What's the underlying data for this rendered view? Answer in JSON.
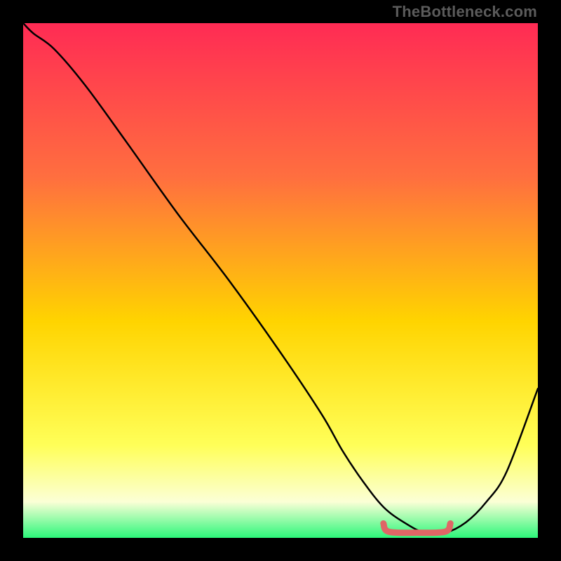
{
  "watermark": "TheBottleneck.com",
  "colors": {
    "gradient_top": "#ff2b54",
    "gradient_mid_upper": "#ff6f3f",
    "gradient_mid": "#ffd400",
    "gradient_lower": "#ffff58",
    "gradient_pale": "#fbffd6",
    "gradient_bottom": "#2cf77a",
    "curve": "#000000",
    "accent": "#e06666"
  },
  "chart_data": {
    "type": "line",
    "title": "",
    "xlabel": "",
    "ylabel": "",
    "xlim": [
      0,
      100
    ],
    "ylim": [
      0,
      100
    ],
    "grid": false,
    "legend": false,
    "series": [
      {
        "name": "bottleneck-curve",
        "x": [
          0,
          2,
          6,
          12,
          20,
          30,
          40,
          50,
          58,
          62,
          66,
          70,
          74,
          78,
          82,
          86,
          90,
          94,
          100
        ],
        "y": [
          100,
          98,
          95,
          88,
          77,
          63,
          50,
          36,
          24,
          17,
          11,
          6,
          3,
          1,
          1,
          3,
          7,
          13,
          29
        ]
      }
    ],
    "accent_segment": {
      "name": "flat-bottom",
      "x_start": 70,
      "x_end": 83,
      "y": 1
    }
  }
}
